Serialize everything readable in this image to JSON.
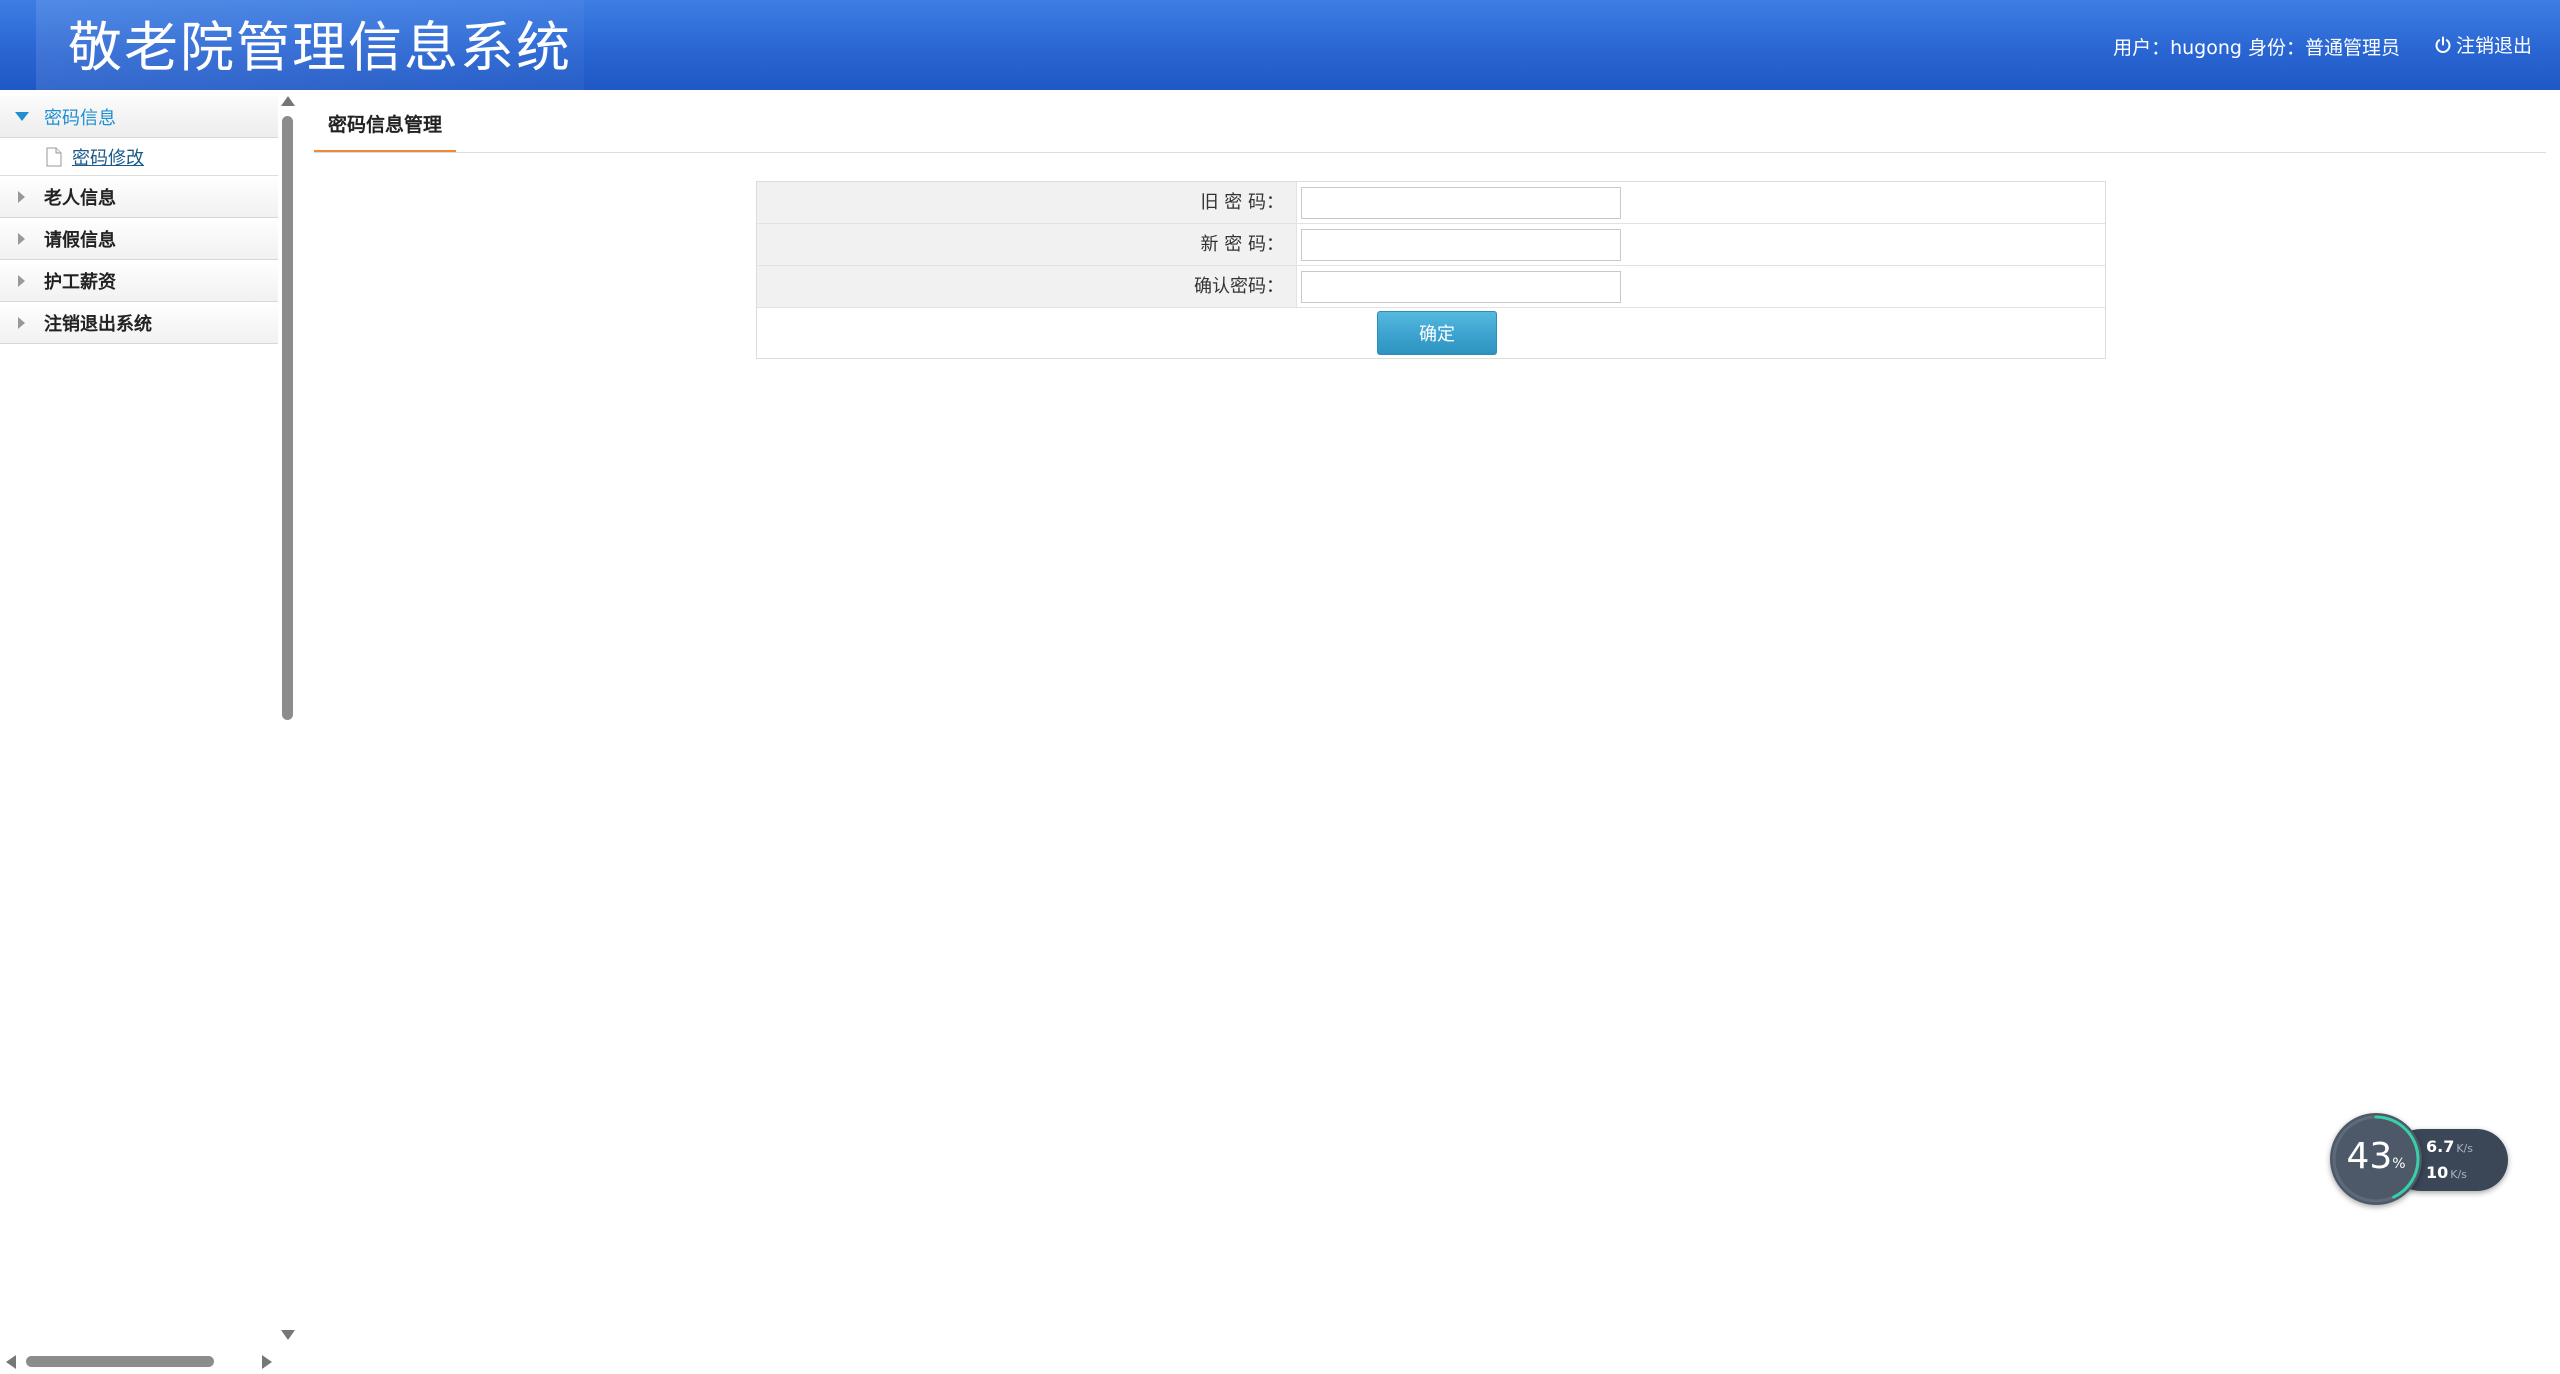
{
  "header": {
    "title": "敬老院管理信息系统",
    "user_info": "用户：hugong 身份：普通管理员",
    "logout_label": "注销退出"
  },
  "sidebar": {
    "groups": [
      {
        "label": "密码信息",
        "expanded": true,
        "items": [
          {
            "label": "密码修改"
          }
        ]
      },
      {
        "label": "老人信息",
        "expanded": false
      },
      {
        "label": "请假信息",
        "expanded": false
      },
      {
        "label": "护工薪资",
        "expanded": false
      },
      {
        "label": "注销退出系统",
        "expanded": false
      }
    ]
  },
  "main": {
    "tab_label": "密码信息管理",
    "form": {
      "old_password_label": "旧 密 码：",
      "new_password_label": "新 密 码：",
      "confirm_password_label": "确认密码：",
      "old_password_value": "",
      "new_password_value": "",
      "confirm_password_value": "",
      "submit_label": "确定"
    }
  },
  "net_widget": {
    "percent": "43",
    "percent_sign": "%",
    "upload_speed": "6.7",
    "upload_unit": "K/s",
    "download_speed": "10",
    "download_unit": "K/s"
  },
  "colors": {
    "header_blue": "#2a66d3",
    "active_menu": "#1e8fd2",
    "tab_underline": "#f0883a",
    "button": "#3ba3cf"
  }
}
